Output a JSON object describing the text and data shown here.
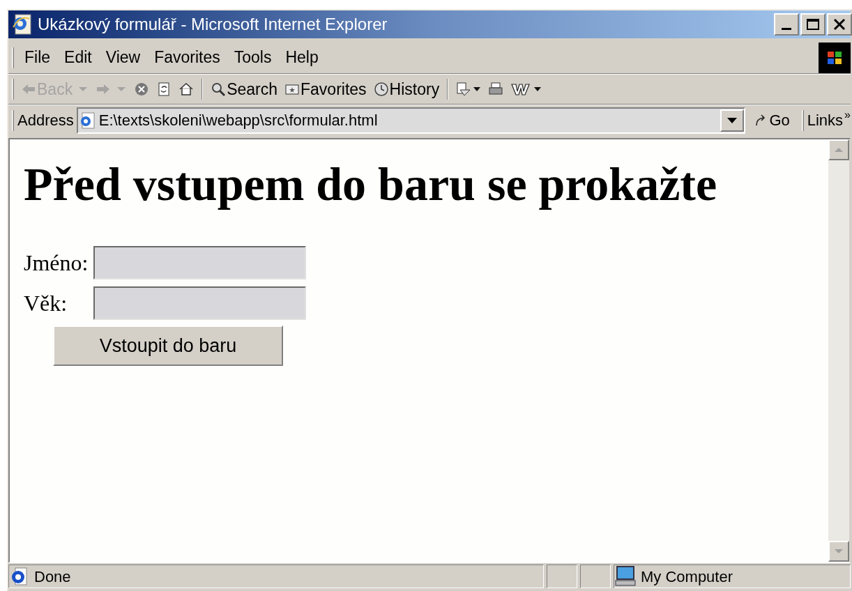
{
  "window": {
    "title": "Ukázkový formulář - Microsoft Internet Explorer"
  },
  "menu": [
    "File",
    "Edit",
    "View",
    "Favorites",
    "Tools",
    "Help"
  ],
  "toolbar": [
    {
      "kind": "back",
      "label": "Back",
      "disabled": true
    },
    {
      "kind": "forward",
      "disabled": true
    },
    {
      "kind": "stop",
      "disabled": false
    },
    {
      "kind": "refresh",
      "disabled": false
    },
    {
      "kind": "home",
      "disabled": false
    },
    {
      "kind": "search",
      "label": "Search",
      "disabled": false
    },
    {
      "kind": "favorites",
      "label": "Favorites",
      "disabled": false
    },
    {
      "kind": "history",
      "label": "History",
      "disabled": false
    },
    {
      "kind": "mail",
      "disabled": false
    },
    {
      "kind": "print",
      "disabled": false
    },
    {
      "kind": "edit",
      "disabled": false
    }
  ],
  "address": {
    "label": "Address",
    "value": "E:\\texts\\skoleni\\webapp\\src\\formular.html",
    "go": "Go",
    "links": "Links",
    "more": "»"
  },
  "page": {
    "heading": "Před vstupem do baru se prokažte",
    "fields": [
      {
        "label": "Jméno:"
      },
      {
        "label": "Věk:"
      }
    ],
    "submit": "Vstoupit do baru"
  },
  "status_bar": {
    "text": "Done",
    "zone": "My Computer"
  }
}
